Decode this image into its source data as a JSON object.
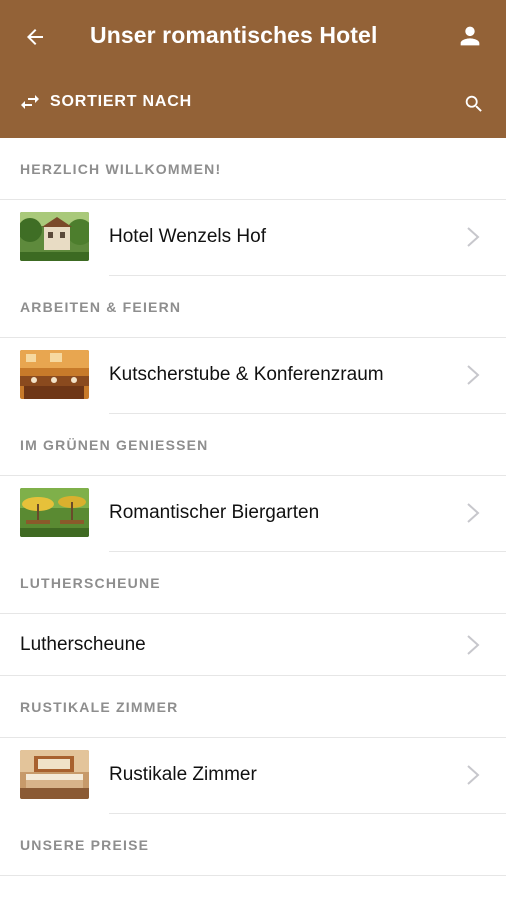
{
  "header": {
    "title": "Unser romantisches Hotel",
    "sort_label": "SORTIERT NACH",
    "brand_color": "#936237"
  },
  "sections": [
    {
      "title": "HERZLICH WILLKOMMEN!",
      "item": {
        "label": "Hotel Wenzels Hof",
        "thumb": "hotel-exterior-photo"
      }
    },
    {
      "title": "ARBEITEN & FEIERN",
      "item": {
        "label": "Kutscherstube & Konferenzraum",
        "thumb": "conference-room-photo"
      }
    },
    {
      "title": "IM GRÜNEN GENIESSEN",
      "item": {
        "label": "Romantischer Biergarten",
        "thumb": "beer-garden-photo"
      }
    },
    {
      "title": "LUTHERSCHEUNE",
      "item": {
        "label": "Lutherscheune"
      }
    },
    {
      "title": "RUSTIKALE ZIMMER",
      "item": {
        "label": "Rustikale Zimmer",
        "thumb": "hotel-room-photo"
      }
    },
    {
      "title": "UNSERE PREISE"
    }
  ]
}
